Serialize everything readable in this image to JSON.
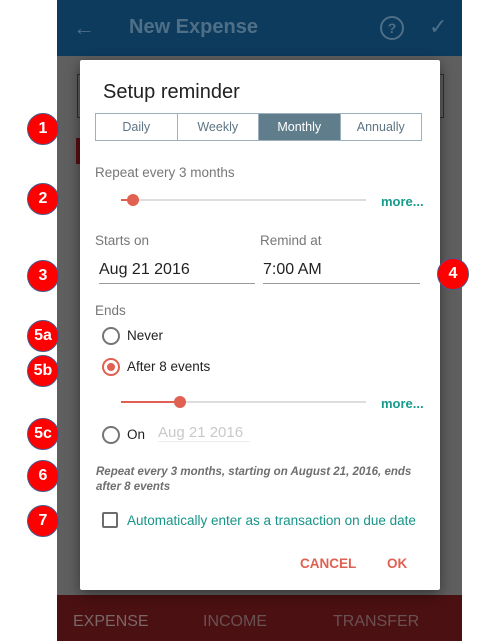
{
  "appbar": {
    "back_icon": "arrow-left-icon",
    "title": "New Expense",
    "help_icon": "?",
    "confirm_icon": "✓"
  },
  "bottom_tabs": [
    "EXPENSE",
    "INCOME",
    "TRANSFER"
  ],
  "dialog": {
    "title": "Setup reminder",
    "frequency_tabs": [
      "Daily",
      "Weekly",
      "Monthly",
      "Annually"
    ],
    "selected_frequency": "Monthly",
    "repeat_label": "Repeat every 3 months",
    "repeat_slider_fraction": 0.05,
    "more_label": "more...",
    "starts_on_label": "Starts on",
    "starts_on_value": "Aug 21 2016",
    "remind_at_label": "Remind at",
    "remind_at_value": "7:00 AM",
    "ends_label": "Ends",
    "ends_options": {
      "never": "Never",
      "after": "After 8 events",
      "on": "On"
    },
    "ends_selected": "after",
    "events_slider_fraction": 0.24,
    "ends_on_date": "Aug 21 2016",
    "summary": "Repeat every 3 months, starting on August 21, 2016, ends after 8 events",
    "auto_enter_label": "Automatically enter as a transaction on due date",
    "auto_enter_checked": false,
    "cancel_label": "CANCEL",
    "ok_label": "OK"
  },
  "annotations": [
    "1",
    "2",
    "3",
    "4",
    "5a",
    "5b",
    "5c",
    "6",
    "7"
  ],
  "colors": {
    "accent": "#e06151",
    "teal": "#179a8a",
    "segment_active": "#607d8b",
    "appbar": "#0c3b5e",
    "badge": "#ff0000"
  }
}
